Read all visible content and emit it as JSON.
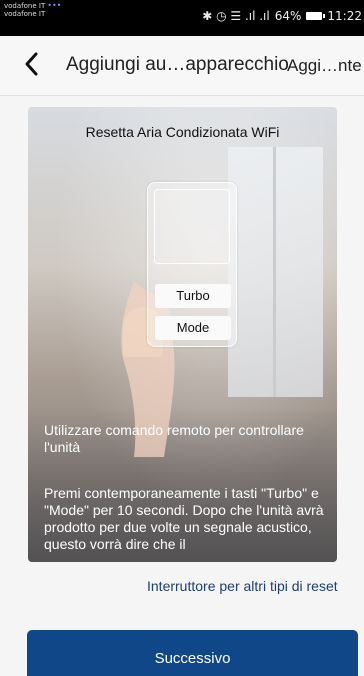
{
  "status_bar": {
    "carrier_line1": "vodafone IT",
    "carrier_line2": "vodafone IT",
    "icons_text": "✱ ◷ ☰ .ıl .ıl",
    "battery_pct": "64%",
    "time": "11:22"
  },
  "nav": {
    "title": "Aggiungi au…apparecchio",
    "right_action": "Aggi…nte"
  },
  "card": {
    "title": "Resetta Aria Condizionata WiFi",
    "remote_buttons": [
      "Turbo",
      "Mode"
    ],
    "instruction_1": "Utilizzare comando remoto per controllare l'unità",
    "instruction_2": "Premi contemporaneamente i tasti \"Turbo\" e \"Mode\" per 10 secondi. Dopo che l'unità avrà prodotto per due volte un segnale acustico, questo vorrà dire che il"
  },
  "reset_link": "Interruttore per altri tipi di reset",
  "next_button": "Successivo",
  "colors": {
    "primary": "#0f4789",
    "link": "#1d3f75",
    "background": "#f5f5f5"
  }
}
